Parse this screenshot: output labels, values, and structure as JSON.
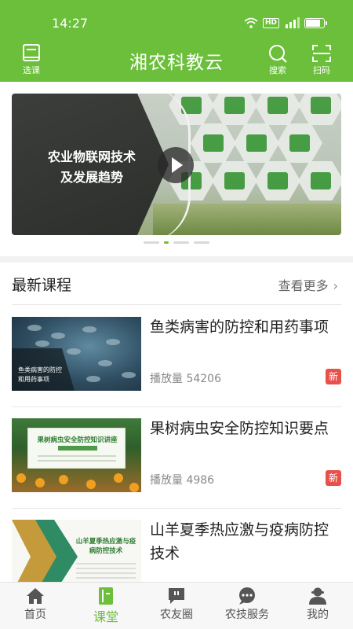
{
  "status_bar": {
    "time": "14:27",
    "hd": "HD"
  },
  "header": {
    "title": "湘农科教云",
    "left_button": {
      "label": "选课",
      "icon": "book-icon"
    },
    "right_buttons": [
      {
        "label": "搜索",
        "icon": "search-icon"
      },
      {
        "label": "扫码",
        "icon": "scan-icon"
      }
    ]
  },
  "banner": {
    "title_line1": "农业物联网技术",
    "title_line2": "及发展趋势",
    "slide_count": 4,
    "active_slide": 1
  },
  "latest_courses": {
    "section_title": "最新课程",
    "more_label": "查看更多",
    "items": [
      {
        "title": "鱼类病害的防控和用药事项",
        "plays": "播放量 54206",
        "badge": "新",
        "thumb_text": "鱼类病害的防控\n和用药事项"
      },
      {
        "title": "果树病虫安全防控知识要点",
        "plays": "播放量 4986",
        "badge": "新",
        "thumb_text": "果树病虫安全防控知识讲座"
      },
      {
        "title": "山羊夏季热应激与疫病防控技术",
        "plays": "",
        "badge": "",
        "thumb_text": "山羊夏季热应激与疫病防控技术"
      }
    ]
  },
  "bottom_nav": {
    "active": 1,
    "items": [
      {
        "label": "首页",
        "icon": "home-icon"
      },
      {
        "label": "课堂",
        "icon": "classroom-icon"
      },
      {
        "label": "农友圈",
        "icon": "chat-bubble-icon"
      },
      {
        "label": "农技服务",
        "icon": "service-icon"
      },
      {
        "label": "我的",
        "icon": "profile-icon"
      }
    ]
  },
  "colors": {
    "brand_green": "#6bbf3b",
    "badge_red": "#e8504a"
  }
}
